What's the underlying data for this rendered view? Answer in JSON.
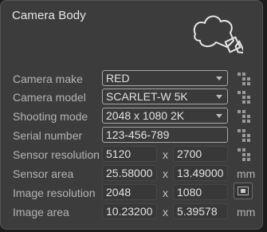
{
  "panel": {
    "title": "Camera Body",
    "icon": "camera-body-icon"
  },
  "rows": {
    "camera_make": {
      "label": "Camera make",
      "value": "RED"
    },
    "camera_model": {
      "label": "Camera model",
      "value": "SCARLET-W 5K"
    },
    "shooting_mode": {
      "label": "Shooting mode",
      "value": "2048 x 1080 2K"
    },
    "serial_number": {
      "label": "Serial number",
      "value": "123-456-789"
    },
    "sensor_resolution": {
      "label": "Sensor resolution",
      "width": "5120",
      "height": "2700"
    },
    "sensor_area": {
      "label": "Sensor area",
      "width": "25.58000",
      "height": "13.49000",
      "unit": "mm"
    },
    "image_resolution": {
      "label": "Image resolution",
      "width": "2048",
      "height": "1080"
    },
    "image_area": {
      "label": "Image area",
      "width": "10.23200",
      "height": "5.39578",
      "unit": "mm"
    }
  },
  "separator": "x",
  "icons": {
    "preset_grid": "grid-preset-icon",
    "fit": "fit-to-sensor-icon",
    "dropdown": "chevron-down-icon"
  },
  "colors": {
    "panel_bg": "#3c3c3c",
    "field_border": "#a8a8a8",
    "label": "#b4b4b4"
  }
}
